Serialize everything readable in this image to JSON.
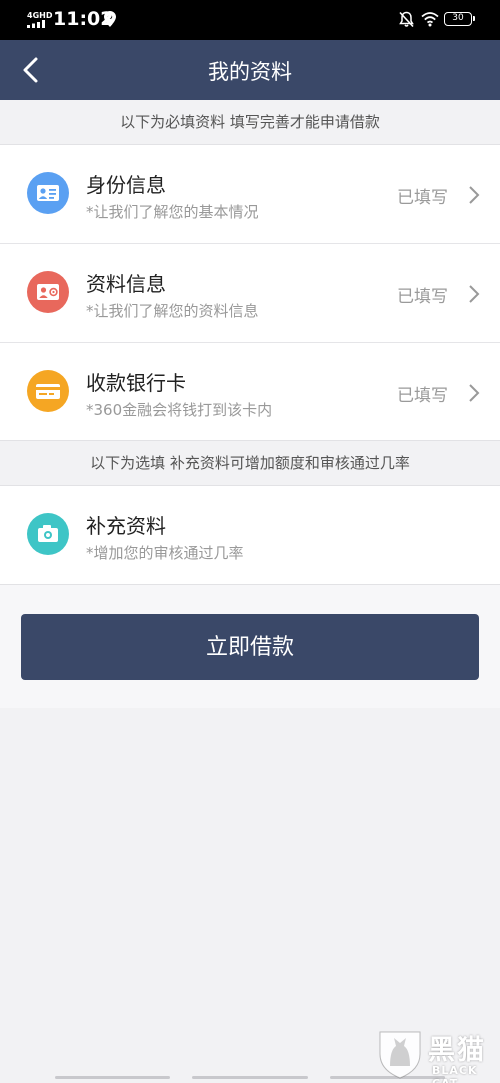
{
  "status_bar": {
    "network": "4GHD",
    "time": "11:02",
    "battery": "30"
  },
  "nav": {
    "title": "我的资料"
  },
  "required_notice": "以下为必填资料 填写完善才能申请借款",
  "required_items": [
    {
      "title": "身份信息",
      "subtitle": "*让我们了解您的基本情况",
      "status": "已填写",
      "icon": "id-card-icon",
      "icon_color": "#5aa0f2"
    },
    {
      "title": "资料信息",
      "subtitle": "*让我们了解您的资料信息",
      "status": "已填写",
      "icon": "profile-card-icon",
      "icon_color": "#e8685c"
    },
    {
      "title": "收款银行卡",
      "subtitle": "*360金融会将钱打到该卡内",
      "status": "已填写",
      "icon": "bank-card-icon",
      "icon_color": "#f5a623"
    }
  ],
  "optional_notice": "以下为选填 补充资料可增加额度和审核通过几率",
  "optional_items": [
    {
      "title": "补充资料",
      "subtitle": "*增加您的审核通过几率",
      "icon": "camera-icon",
      "icon_color": "#3ec5c6"
    }
  ],
  "cta_label": "立即借款",
  "watermark": {
    "title": "黑猫",
    "subtitle": "BLACK CAT"
  },
  "colors": {
    "nav_bg": "#3a4868",
    "button_bg": "#3a4868",
    "page_bg": "#f2f2f4"
  }
}
